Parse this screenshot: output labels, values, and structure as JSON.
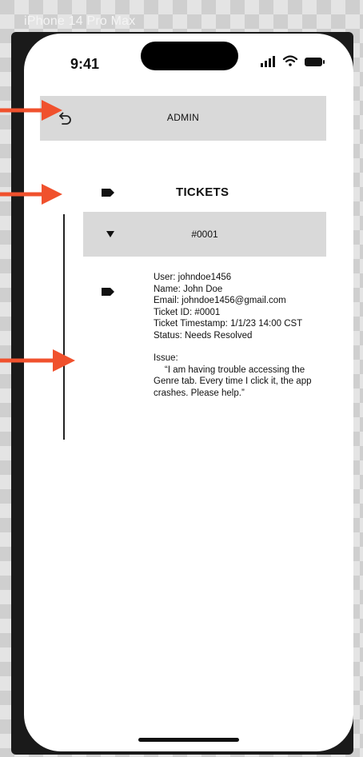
{
  "frame_label": "iPhone 14 Pro Max",
  "status_bar": {
    "time": "9:41"
  },
  "header": {
    "title": "ADMIN",
    "back_icon": "undo-arrow-icon"
  },
  "tickets": {
    "title": "TICKETS",
    "tag_icon": "tag-icon",
    "items": [
      {
        "id": "#0001",
        "expanded": true,
        "details": [
          "User: johndoe1456",
          "Name: John Doe",
          "Email: johndoe1456@gmail.com",
          "Ticket ID: #0001",
          "Ticket Timestamp: 1/1/23 14:00 CST",
          "Status: Needs Resolved"
        ],
        "issue_label": "Issue:",
        "issue_text": "“I am having trouble accessing the Genre tab. Every time I click it, the app crashes. Please help.”"
      }
    ]
  },
  "colors": {
    "annotation_arrow": "#f0512d",
    "header_bg": "#d9d9d9",
    "row_bg": "#d9d9d9"
  }
}
